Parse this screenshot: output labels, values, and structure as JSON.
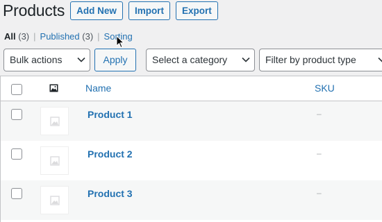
{
  "header": {
    "title": "Products",
    "add_new_label": "Add New",
    "import_label": "Import",
    "export_label": "Export"
  },
  "views": {
    "all_label": "All",
    "all_count": "(3)",
    "published_label": "Published",
    "published_count": "(3)",
    "sorting_label": "Sorting",
    "separator": "|"
  },
  "tablenav": {
    "bulk_actions": "Bulk actions",
    "apply_label": "Apply",
    "category_filter": "Select a category",
    "type_filter": "Filter by product type"
  },
  "table": {
    "columns": {
      "name": "Name",
      "sku": "SKU"
    },
    "rows": [
      {
        "name": "Product 1",
        "sku": "–"
      },
      {
        "name": "Product 2",
        "sku": "–"
      },
      {
        "name": "Product 3",
        "sku": "–"
      }
    ]
  },
  "colors": {
    "accent": "#2271b1",
    "background": "#f0f0f1",
    "text": "#1d2327"
  },
  "icons": {
    "column_image": "image-icon",
    "row_placeholder": "image-placeholder-icon",
    "dropdown": "chevron-down-icon",
    "cursor": "mouse-pointer-icon"
  }
}
